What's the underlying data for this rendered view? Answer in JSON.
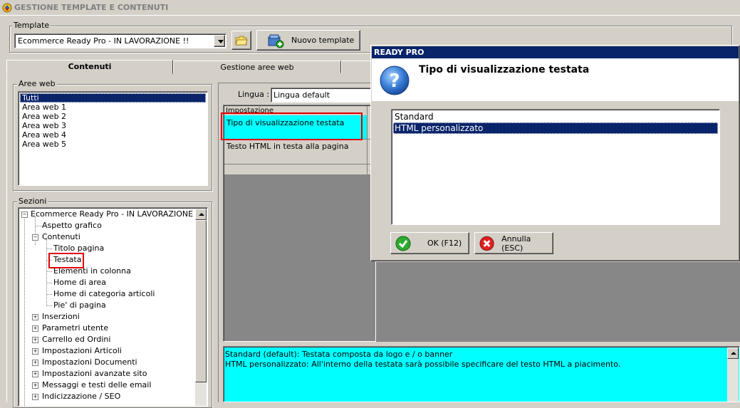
{
  "window": {
    "title": "GESTIONE TEMPLATE E CONTENUTI"
  },
  "template_group": {
    "label": "Template",
    "selected": "Ecommerce Ready Pro - IN LAVORAZIONE !!",
    "new_button": "Nuovo template"
  },
  "tabs": [
    {
      "label": "Contenuti",
      "active": true
    },
    {
      "label": "Gestione aree web",
      "active": false
    }
  ],
  "aree_web": {
    "label": "Aree web",
    "items": [
      "Tutti",
      "Area web 1",
      "Area web 2",
      "Area web 3",
      "Area web 4",
      "Area web 5"
    ],
    "selected_index": 0
  },
  "sezioni": {
    "label": "Sezioni",
    "root": "Ecommerce Ready Pro - IN LAVORAZIONE !!",
    "items": [
      "Aspetto grafico",
      "Contenuti",
      "Titolo pagina",
      "Testata",
      "Elementi in colonna",
      "Home di area",
      "Home di categoria articoli",
      "Pie' di pagina",
      "Inserzioni",
      "Parametri utente",
      "Carrello ed Ordini",
      "Impostazioni Articoli",
      "Impostazioni Documenti",
      "Impostazioni avanzate sito",
      "Messaggi e testi delle email",
      "Indicizzazione / SEO"
    ]
  },
  "lingua": {
    "label": "Lingua :",
    "value": "Lingua default"
  },
  "grid": {
    "header": "Impostazione",
    "rows": [
      "Tipo di visualizzazione testata",
      "Testo HTML in testa alla pagina"
    ]
  },
  "description": {
    "line1": "Standard (default): Testata composta da logo e / o banner",
    "line2": "HTML personalizzato: All'interno della testata sarà possibile specificare del testo HTML a piacimento."
  },
  "dialog": {
    "title": "READY PRO",
    "heading": "Tipo di visualizzazione testata",
    "options": [
      "Standard",
      "HTML personalizzato"
    ],
    "selected_index": 1,
    "ok": "OK (F12)",
    "cancel": "Annulla (ESC)"
  },
  "colors": {
    "selection": "#0a246a",
    "cyan": "#00ffff",
    "highlight_red": "#e00000",
    "dark_panel": "#878787"
  }
}
